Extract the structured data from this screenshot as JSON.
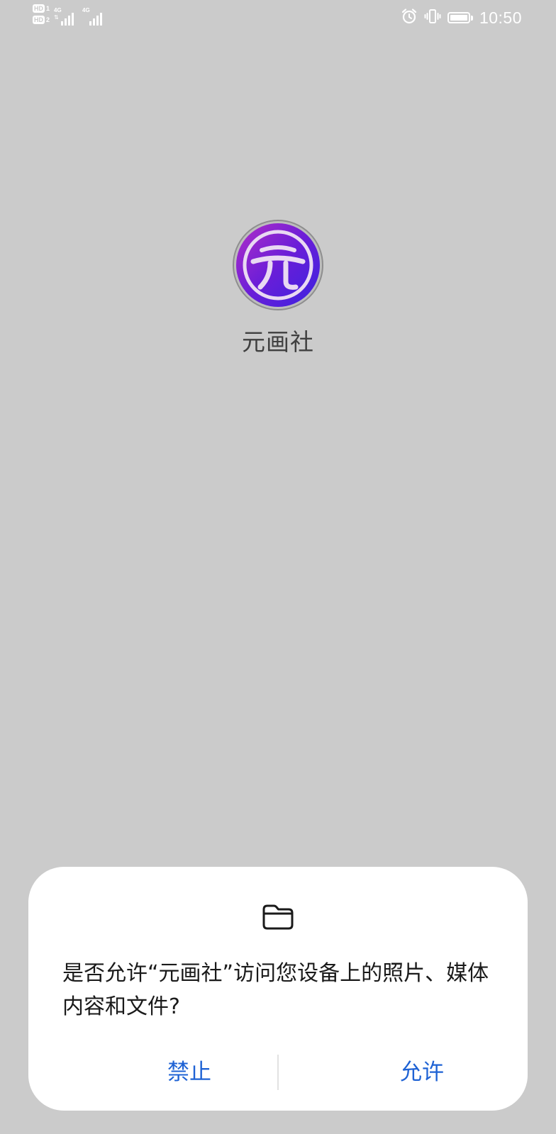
{
  "status_bar": {
    "sim1_badge": "HD",
    "sim1_num": "1",
    "sim2_badge": "HD",
    "sim2_num": "2",
    "sim1_network": "4G",
    "sim2_network": "4G",
    "data_arrows": "⇅",
    "time": "10:50",
    "icons": [
      "alarm-icon",
      "vibrate-icon",
      "battery-icon"
    ]
  },
  "app": {
    "name": "元画社",
    "icon": "app-logo-icon",
    "logo_colors": [
      "#b22ec7",
      "#6a1ed8",
      "#3b22e0"
    ]
  },
  "dialog": {
    "icon": "folder-icon",
    "message": "是否允许“元画社”访问您设备上的照片、媒体内容和文件?",
    "deny_label": "禁止",
    "allow_label": "允许",
    "button_color": "#1e62d4"
  }
}
